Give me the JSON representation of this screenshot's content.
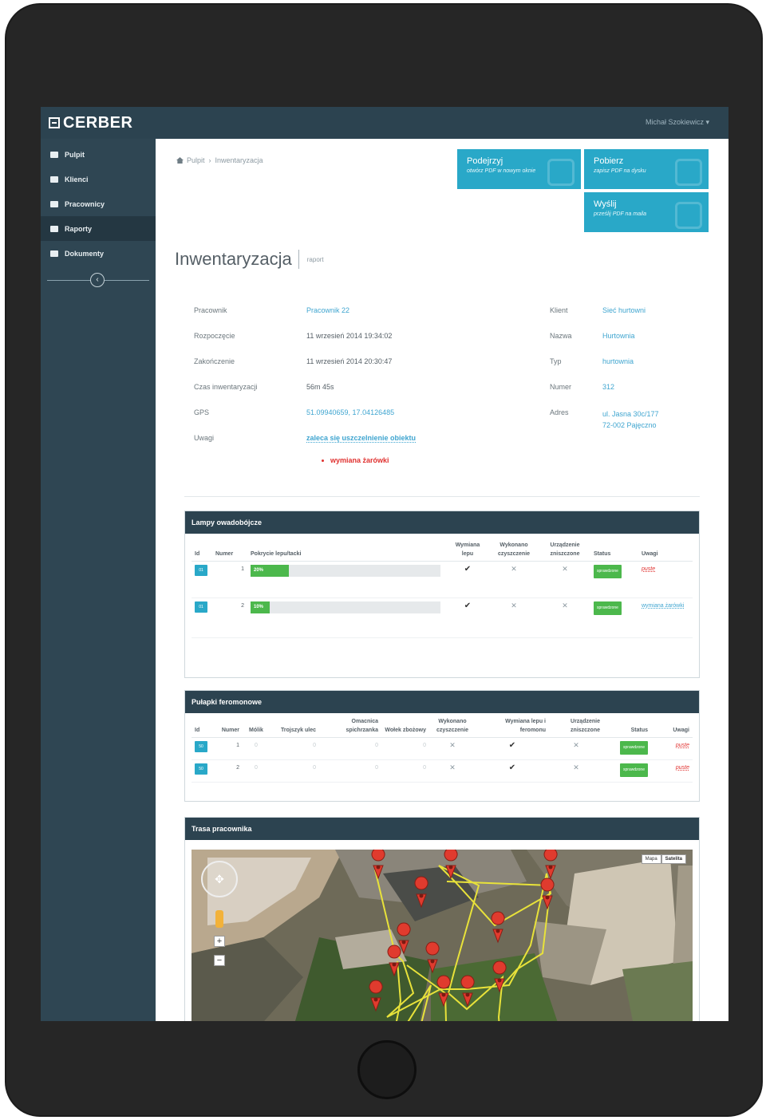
{
  "app": {
    "logo_text": "CERBER",
    "user_menu": "Michał Szokiewicz ▾"
  },
  "sidebar": {
    "items": [
      {
        "label": "Pulpit",
        "icon": "dashboard-icon"
      },
      {
        "label": "Klienci",
        "icon": "briefcase-icon"
      },
      {
        "label": "Pracownicy",
        "icon": "wrench-icon"
      },
      {
        "label": "Raporty",
        "icon": "list-icon",
        "active": true
      },
      {
        "label": "Dokumenty",
        "icon": "documents-icon"
      }
    ],
    "collapse_icon": "chevron-left-icon",
    "collapse_glyph": "‹"
  },
  "breadcrumb": {
    "home": "Pulpit",
    "separator": "›",
    "current": "Inwentaryzacja"
  },
  "actions": {
    "preview": {
      "title": "Podejrzyj",
      "subtitle": "otwórz PDF w nowym oknie"
    },
    "download": {
      "title": "Pobierz",
      "subtitle": "zapisz PDF na dysku"
    },
    "send": {
      "title": "Wyślij",
      "subtitle": "prześlij PDF na maila"
    }
  },
  "page": {
    "title": "Inwentaryzacja",
    "subtitle": "raport"
  },
  "details": {
    "left": [
      {
        "label": "Pracownik",
        "value": "Pracownik 22"
      },
      {
        "label": "Rozpoczęcie",
        "value": "11 wrzesień 2014 19:34:02"
      },
      {
        "label": "Zakończenie",
        "value": "11 wrzesień 2014 20:30:47"
      },
      {
        "label": "Czas inwentaryzacji",
        "value": "56m 45s"
      },
      {
        "label": "GPS",
        "value": "51.09940659, 17.04126485"
      },
      {
        "label": "Uwagi",
        "value": "zaleca się uszczelnienie obiektu"
      }
    ],
    "note_bullet": "wymiana żarówki",
    "right": [
      {
        "label": "Klient",
        "value": "Sieć hurtowni"
      },
      {
        "label": "Nazwa",
        "value": "Hurtownia"
      },
      {
        "label": "Typ",
        "value": "hurtownia"
      },
      {
        "label": "Numer",
        "value": "312"
      },
      {
        "label": "Adres",
        "value": "ul. Jasna 30c/177",
        "value2": "72-002 Pajęczno"
      }
    ]
  },
  "lamps": {
    "title": "Lampy owadobójcze",
    "headers": [
      "Id",
      "Numer",
      "Pokrycie lepu/tacki",
      "Wymiana lepu",
      "Wykonano czyszczenie",
      "Urządzenie zniszczone",
      "Status",
      "Uwagi"
    ],
    "rows": [
      {
        "id": "01",
        "number": "1",
        "coverage_label": "20%",
        "coverage": 0.2,
        "replace": "✔",
        "cleaned": "✕",
        "destroyed": "✕",
        "status": "sprawdzone",
        "note": "puste",
        "note_style": "red"
      },
      {
        "id": "01",
        "number": "2",
        "coverage_label": "10%",
        "coverage": 0.1,
        "replace": "✔",
        "cleaned": "✕",
        "destroyed": "✕",
        "status": "sprawdzone",
        "note": "wymiana żarówki",
        "note_style": "blue"
      }
    ]
  },
  "traps": {
    "title": "Pułapki feromonowe",
    "headers": [
      "Id",
      "Numer",
      "Mólik",
      "Trojszyk ulec",
      "Omacnica spichrzanka",
      "Wołek zbożowy",
      "Wykonano czyszczenie",
      "Wymiana lepu i feromonu",
      "Urządzenie zniszczone",
      "Status",
      "Uwagi"
    ],
    "rows": [
      {
        "id": "50",
        "number": "1",
        "molik": "0",
        "trojszyk": "0",
        "omacnica": "0",
        "wolek": "0",
        "cleaned": "✕",
        "replace": "✔",
        "destroyed": "✕",
        "status": "sprawdzone",
        "note": "puste"
      },
      {
        "id": "50",
        "number": "2",
        "molik": "0",
        "trojszyk": "0",
        "omacnica": "0",
        "wolek": "0",
        "cleaned": "✕",
        "replace": "✔",
        "destroyed": "✕",
        "status": "sprawdzone",
        "note": "puste"
      }
    ]
  },
  "route": {
    "title": "Trasa pracownika",
    "map_types": [
      "Mapa",
      "Satelita"
    ],
    "pan_glyph": "✥",
    "zoom_in": "+",
    "zoom_out": "−"
  },
  "colors": {
    "sidebar": "#2f4653",
    "topbar": "#2c4350",
    "accent": "#29a8c8",
    "success": "#4cb84c",
    "danger": "#e0312f",
    "link": "#3fa5d0"
  }
}
